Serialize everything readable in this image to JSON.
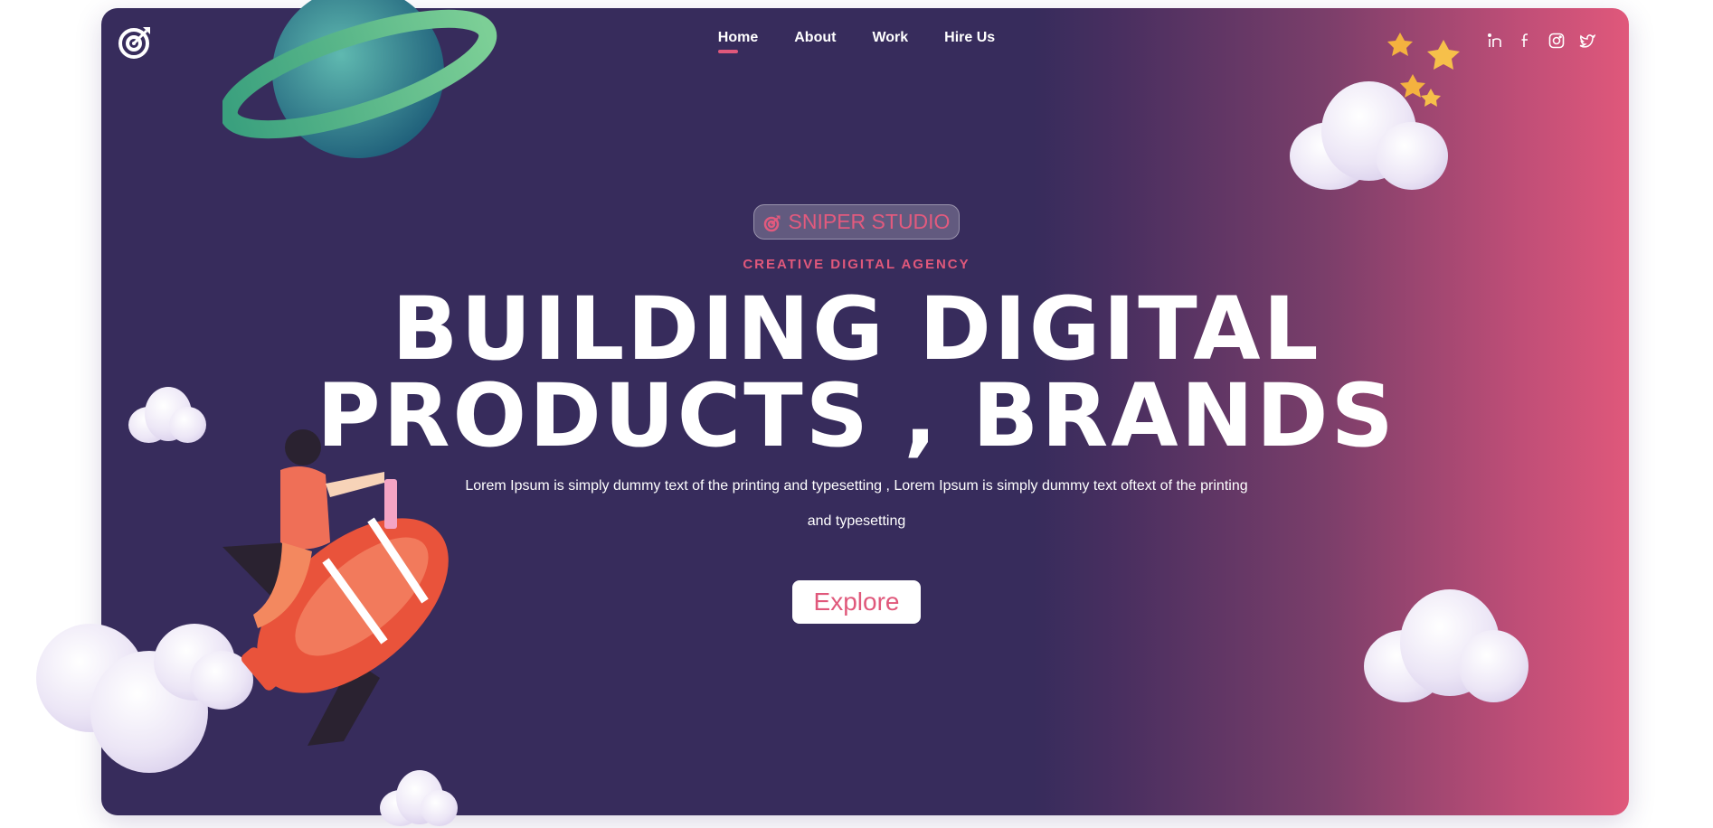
{
  "brand": {
    "logo_icon": "target-arrow-icon"
  },
  "nav": {
    "items": [
      {
        "label": "Home",
        "active": true
      },
      {
        "label": "About",
        "active": false
      },
      {
        "label": "Work",
        "active": false
      },
      {
        "label": "Hire Us",
        "active": false
      }
    ]
  },
  "socials": [
    {
      "icon": "linkedin-icon"
    },
    {
      "icon": "facebook-icon"
    },
    {
      "icon": "instagram-icon"
    },
    {
      "icon": "twitter-icon"
    }
  ],
  "hero": {
    "badge_icon": "target-arrow-icon",
    "badge_text": "SNIPER STUDIO",
    "tagline": "CREATIVE DIGITAL AGENCY",
    "headline_line1": "BUILDING DIGITAL",
    "headline_line2": "PRODUCTS , BRANDS",
    "description_line1": "Lorem Ipsum is simply dummy text of the printing and typesetting , Lorem Ipsum is simply dummy text oftext of the printing",
    "description_line2": "and typesetting",
    "cta_label": "Explore"
  },
  "colors": {
    "primary_dark": "#372c5c",
    "accent_pink": "#e0587b",
    "text_white": "#ffffff"
  }
}
